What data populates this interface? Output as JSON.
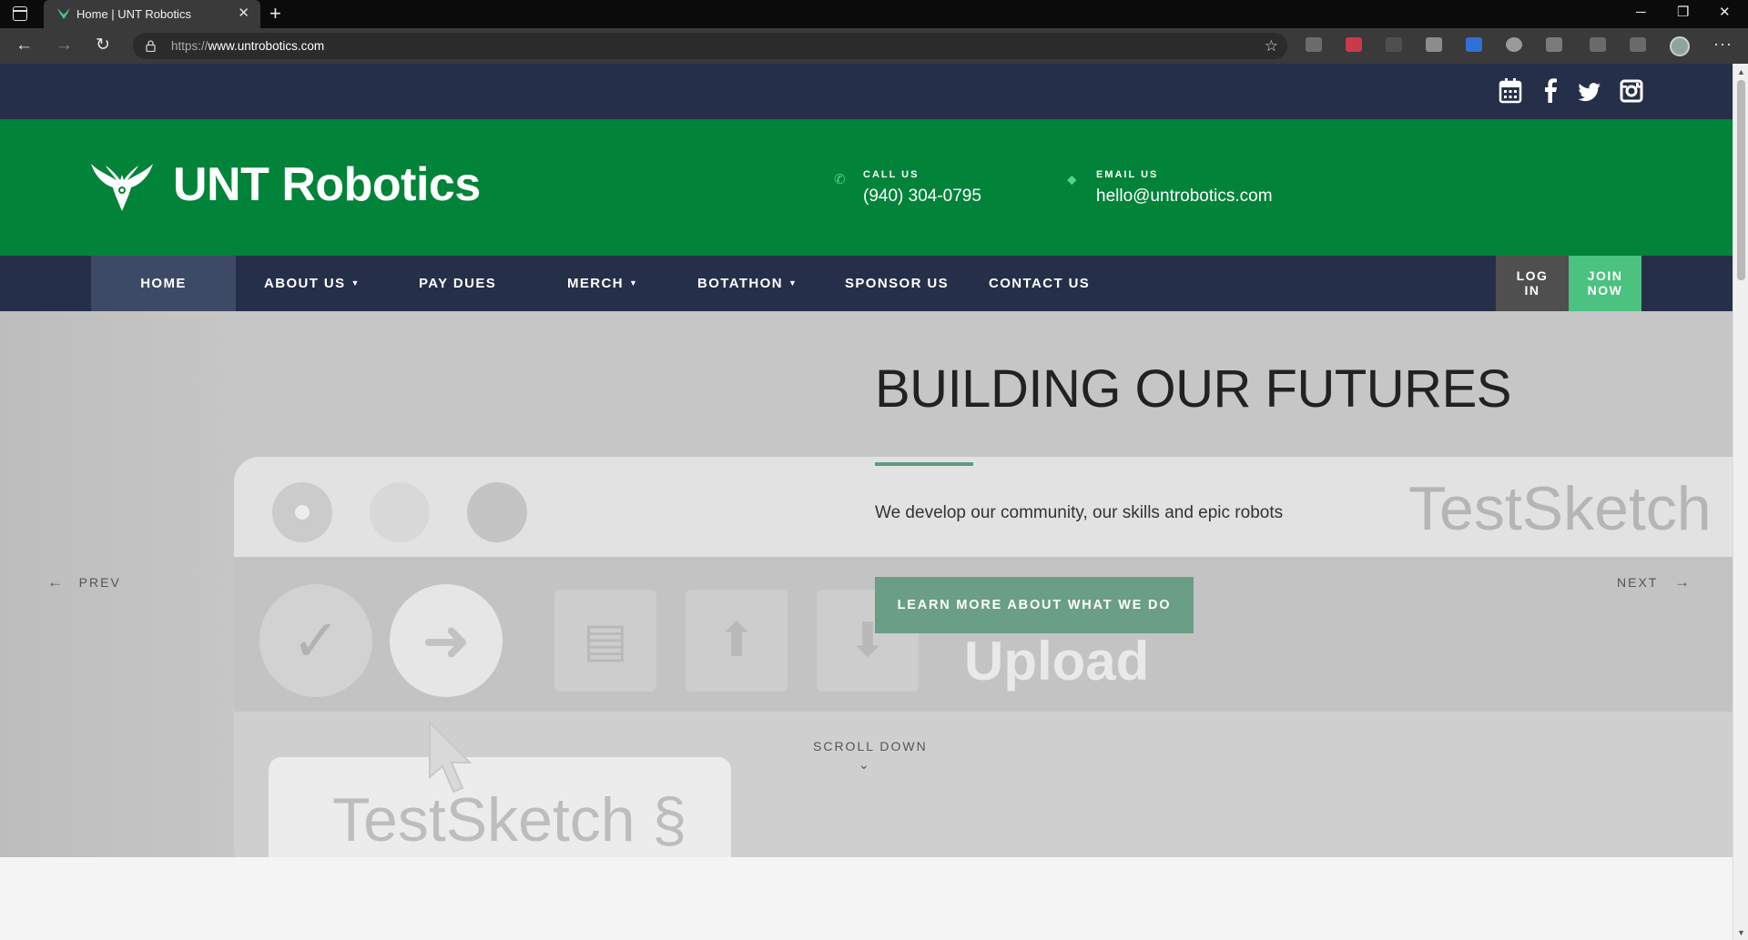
{
  "browser": {
    "tab_title": "Home | UNT Robotics",
    "tab_close": "✕",
    "new_tab": "+",
    "url_protocol": "https://",
    "url_host": "www.untrobotics.com",
    "window_controls": [
      "─",
      "❐",
      "✕"
    ],
    "more_menu": "···"
  },
  "topbar": {
    "social_icons": [
      "calendar-icon",
      "facebook-icon",
      "twitter-icon",
      "instagram-icon"
    ]
  },
  "brand": {
    "name": "UNT Robotics",
    "phone_label": "CALL US",
    "phone_value": "(940) 304-0795",
    "email_label": "EMAIL US",
    "email_value": "hello@untrobotics.com"
  },
  "nav": {
    "items": [
      {
        "label": "HOME",
        "active": true
      },
      {
        "label": "ABOUT US",
        "dropdown": true
      },
      {
        "label": "PAY DUES"
      },
      {
        "label": "MERCH",
        "dropdown": true
      },
      {
        "label": "BOTATHON",
        "dropdown": true
      },
      {
        "label": "SPONSOR US"
      },
      {
        "label": "CONTACT US"
      }
    ],
    "login_line1": "LOG",
    "login_line2": "IN",
    "join_line1": "JOIN",
    "join_line2": "NOW"
  },
  "hero": {
    "title": "BUILDING OUR FUTURES",
    "subtitle": "We develop our community, our skills and epic robots",
    "cta": "LEARN MORE ABOUT WHAT WE DO",
    "prev": "PREV",
    "next": "NEXT",
    "scroll_hint": "SCROLL DOWN",
    "background_text_1": "TestSketch",
    "background_text_2": "TestSketch §",
    "background_text_3": "Upload"
  },
  "colors": {
    "brand_green": "#018339",
    "navy": "#262f49",
    "accent_green": "#4bc27f",
    "cta_green": "#6b9e86"
  }
}
